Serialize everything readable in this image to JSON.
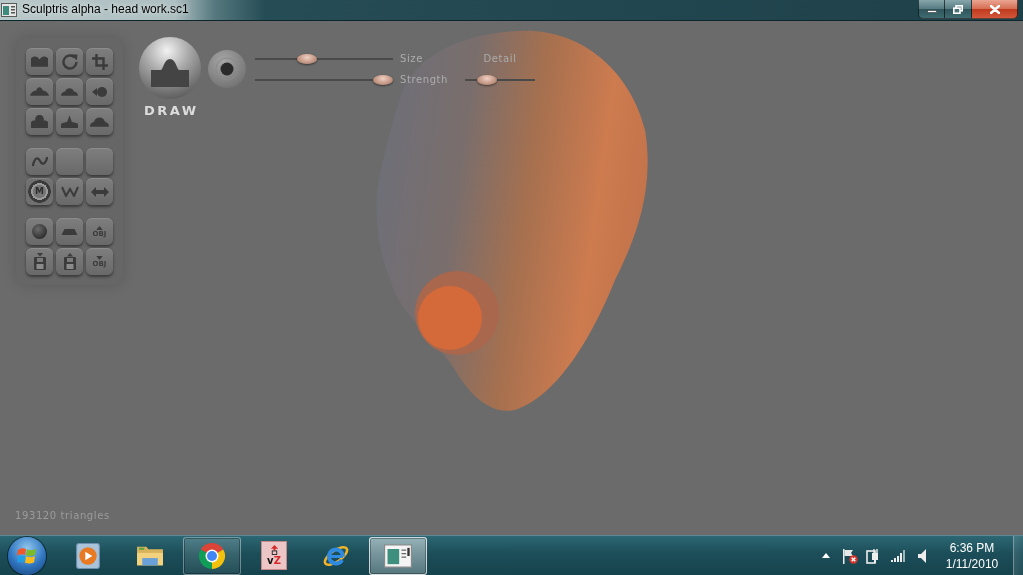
{
  "window": {
    "title": "Sculptris alpha - head work.sc1"
  },
  "tool_palette": {
    "groups": [
      {
        "tools": [
          {
            "kind": "valley"
          },
          {
            "kind": "rotate"
          },
          {
            "kind": "crop"
          },
          {
            "kind": "widemound"
          },
          {
            "kind": "mound"
          },
          {
            "kind": "grab"
          },
          {
            "kind": "bump"
          },
          {
            "kind": "peak"
          },
          {
            "kind": "dome"
          }
        ]
      },
      {
        "tools": [
          {
            "kind": "curve"
          },
          {
            "kind": "empty"
          },
          {
            "kind": "empty"
          },
          {
            "kind": "mask",
            "label": "M"
          },
          {
            "kind": "zigzag"
          },
          {
            "kind": "symmetry"
          }
        ]
      },
      {
        "tools": [
          {
            "kind": "sphere"
          },
          {
            "kind": "plane"
          },
          {
            "kind": "import",
            "label": "OBJ"
          },
          {
            "kind": "save"
          },
          {
            "kind": "open"
          },
          {
            "kind": "export",
            "label": "OBJ"
          }
        ]
      }
    ]
  },
  "brush": {
    "name": "DRAW",
    "sliders": [
      {
        "label": "Size",
        "level": 0.38
      },
      {
        "label": "Strength",
        "level": 0.93
      }
    ],
    "detail": {
      "label": "Detail",
      "level": 0.31
    }
  },
  "viewport": {
    "status": "193120 triangles"
  },
  "taskbar": {
    "items": [
      {
        "kind": "player",
        "running": false,
        "selected": false
      },
      {
        "kind": "folder",
        "running": false,
        "selected": false
      },
      {
        "kind": "ring",
        "running": true,
        "selected": false
      },
      {
        "kind": "tile",
        "label": "vZ",
        "running": false,
        "selected": false
      },
      {
        "kind": "globe",
        "running": false,
        "selected": false
      },
      {
        "kind": "window",
        "running": true,
        "selected": true
      }
    ],
    "clock": {
      "time": "6:36 PM",
      "date": "1/11/2010"
    }
  }
}
